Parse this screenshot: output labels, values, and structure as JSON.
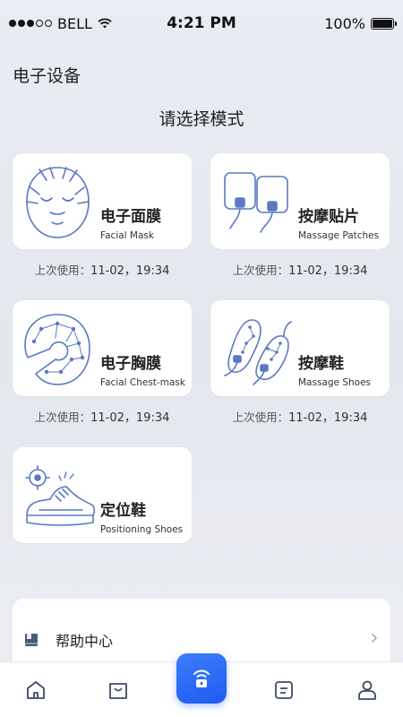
{
  "status_bar": {
    "carrier": "BELL",
    "time": "4:21 PM",
    "battery": "100%"
  },
  "header": {
    "title": "电子设备"
  },
  "section": {
    "title": "请选择模式"
  },
  "devices": [
    {
      "cn": "电子面膜",
      "en": "Facial Mask",
      "last_label": "上次使用：",
      "last_value": "11-02，19:34",
      "icon": "face-mask-icon"
    },
    {
      "cn": "按摩贴片",
      "en": "Massage Patches",
      "last_label": "上次使用：",
      "last_value": "11-02，19:34",
      "icon": "massage-patch-icon"
    },
    {
      "cn": "电子胸膜",
      "en": "Facial Chest-mask",
      "last_label": "上次使用：",
      "last_value": "11-02，19:34",
      "icon": "chest-mask-icon"
    },
    {
      "cn": "按摩鞋",
      "en": "Massage Shoes",
      "last_label": "上次使用：",
      "last_value": "11-02，19:34",
      "icon": "massage-shoes-icon"
    },
    {
      "cn": "定位鞋",
      "en": "Positioning Shoes",
      "icon": "positioning-shoe-icon"
    }
  ],
  "help": {
    "label": "帮助中心",
    "icon": "book-icon"
  },
  "tabs": [
    {
      "icon": "home-icon"
    },
    {
      "icon": "shopping-bag-icon"
    },
    {
      "icon": "device-lock-icon",
      "active": true
    },
    {
      "icon": "document-icon"
    },
    {
      "icon": "user-icon"
    }
  ],
  "colors": {
    "accent": "#2563f2",
    "icon_line": "#5a78c4",
    "background": "#e8ebf1"
  }
}
